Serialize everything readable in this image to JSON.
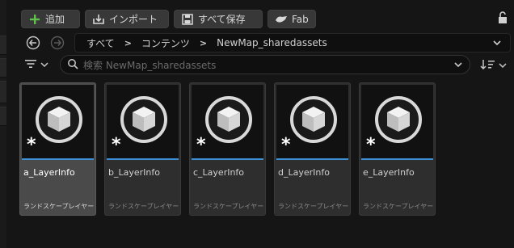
{
  "toolbar": {
    "add_label": "追加",
    "import_label": "インポート",
    "save_all_label": "すべて保存",
    "fab_label": "Fab"
  },
  "breadcrumb": {
    "items": [
      "すべて",
      "コンテンツ",
      "NewMap_sharedassets"
    ]
  },
  "search": {
    "placeholder": "検索 NewMap_sharedassets"
  },
  "assets": [
    {
      "name": "a_LayerInfo",
      "type": "ランドスケープレイヤー",
      "selected": true
    },
    {
      "name": "b_LayerInfo",
      "type": "ランドスケープレイヤー",
      "selected": false
    },
    {
      "name": "c_LayerInfo",
      "type": "ランドスケープレイヤー",
      "selected": false
    },
    {
      "name": "d_LayerInfo",
      "type": "ランドスケープレイヤー",
      "selected": false
    },
    {
      "name": "e_LayerInfo",
      "type": "ランドスケープレイヤー",
      "selected": false
    }
  ],
  "colors": {
    "accent": "#3d8fd6",
    "add_icon": "#5fc24a",
    "background": "#151515"
  },
  "icons": {
    "add": "plus-icon",
    "import": "import-icon",
    "save_all": "save-icon",
    "fab": "fab-icon",
    "lock": "lock-icon",
    "back": "back-arrow-icon",
    "forward": "forward-arrow-icon",
    "filter": "filter-icon",
    "search": "search-icon",
    "sort": "sort-icon",
    "asset_thumbnail": "cube-icon",
    "unsaved_marker": "asterisk-icon"
  }
}
